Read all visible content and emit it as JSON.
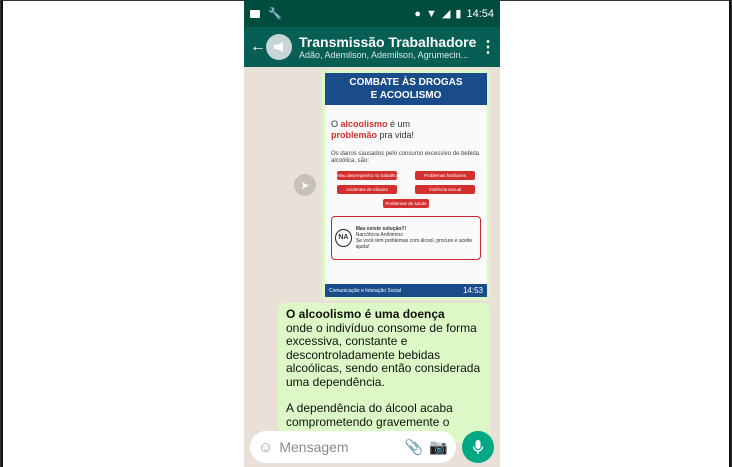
{
  "status_bar": {
    "time": "14:54",
    "battery_label": "▕"
  },
  "header": {
    "title": "Transmissão Trabalhadores",
    "subtitle": "Adão, Ademilson, Ademilson, Agrumecin..."
  },
  "poster": {
    "heading_line1": "COMBATE ÀS DROGAS",
    "heading_line2": "E ACOOLISMO",
    "tagline_pre": "O ",
    "tagline_word1": "alcoolismo",
    "tagline_mid": " é um",
    "tagline_word2": "problemão",
    "tagline_post": " pra vida!",
    "damage_text": "Os danos causados pelo consumo excessivo de bebida alcoólica, são:",
    "pills": [
      "Mau desempenho no trabalho",
      "Problemas familiares",
      "Acidentes de trânsito",
      "Violência sexual",
      "Problemas de saúde mental"
    ],
    "solution_heading": "Mas existe solução!!!",
    "solution_org": "Narcóticos Anônimos",
    "solution_note": "Se você tem problemas com álcool, procure e aceite ajuda!",
    "footer_label": "Comunicação e Interação Social",
    "footer_time": "14:53"
  },
  "message": {
    "para1_bold": "O alcoolismo é uma doença",
    "para1_rest": "onde o indivíduo consome de forma excessiva, constante e descontroladamente bebidas alcoólicas, sendo então considerada uma dependência.",
    "para2": "A dependência do álcool acaba comprometendo gravemente o"
  },
  "composer": {
    "placeholder": "Mensagem"
  },
  "colors": {
    "appbar": "#075e54",
    "bubble": "#dcf8c6",
    "accent": "#00a884"
  }
}
